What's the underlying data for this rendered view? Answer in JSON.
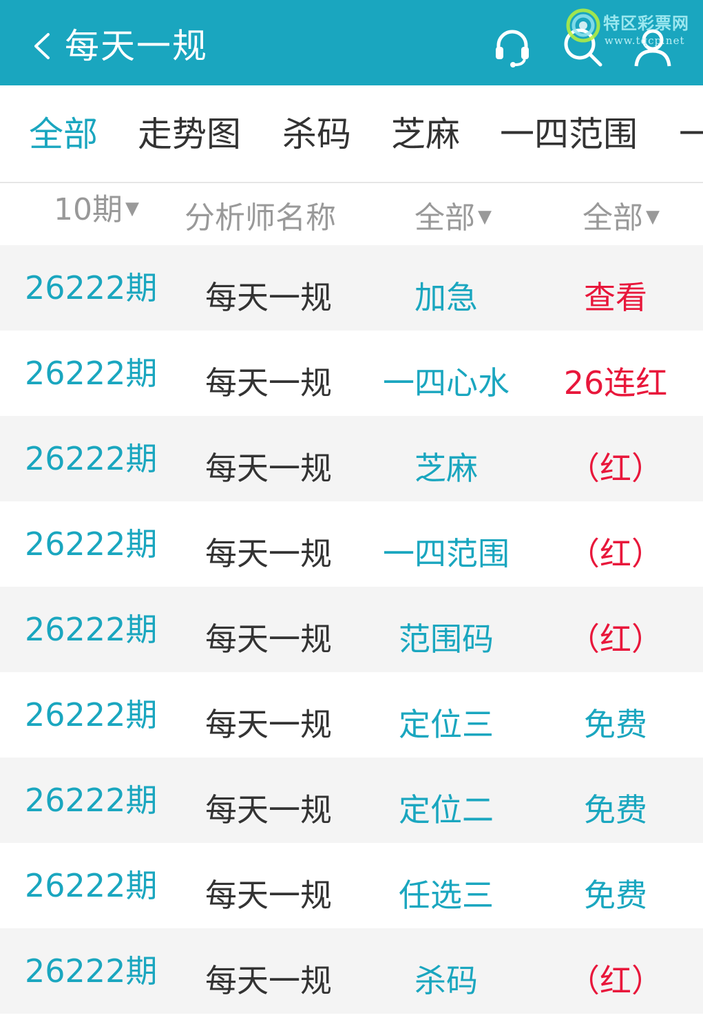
{
  "header": {
    "title": "每天一规",
    "colors": {
      "background": "#1aa6bf",
      "text": "#ffffff"
    },
    "icons": [
      "chevron-left-icon",
      "headset-icon",
      "search-icon",
      "user-icon"
    ]
  },
  "watermark": {
    "brand": "特区彩票网",
    "site": "www.tqcp.net"
  },
  "tabs": [
    {
      "label": "全部",
      "active": true
    },
    {
      "label": "走势图",
      "active": false
    },
    {
      "label": "杀码",
      "active": false
    },
    {
      "label": "芝麻",
      "active": false
    },
    {
      "label": "一四范围",
      "active": false
    },
    {
      "label": "一",
      "active": false
    }
  ],
  "filters": {
    "period": "10期",
    "analyst": "分析师名称",
    "category": "全部",
    "status": "全部",
    "dropdown_glyph": "▼"
  },
  "rows": [
    {
      "period": "26222期",
      "name": "每天一规",
      "category": "加急",
      "status": "查看",
      "status_color": "red"
    },
    {
      "period": "26222期",
      "name": "每天一规",
      "category": "一四心水",
      "status": "26连红",
      "status_color": "red"
    },
    {
      "period": "26222期",
      "name": "每天一规",
      "category": "芝麻",
      "status": "（红）",
      "status_color": "red"
    },
    {
      "period": "26222期",
      "name": "每天一规",
      "category": "一四范围",
      "status": "（红）",
      "status_color": "red"
    },
    {
      "period": "26222期",
      "name": "每天一规",
      "category": "范围码",
      "status": "（红）",
      "status_color": "red"
    },
    {
      "period": "26222期",
      "name": "每天一规",
      "category": "定位三",
      "status": "免费",
      "status_color": "teal"
    },
    {
      "period": "26222期",
      "name": "每天一规",
      "category": "定位二",
      "status": "免费",
      "status_color": "teal"
    },
    {
      "period": "26222期",
      "name": "每天一规",
      "category": "任选三",
      "status": "免费",
      "status_color": "teal"
    },
    {
      "period": "26222期",
      "name": "每天一规",
      "category": "杀码",
      "status": "（红）",
      "status_color": "red"
    }
  ],
  "colors": {
    "accent": "#1aa6bf",
    "red": "#e8173b",
    "text": "#333333",
    "muted": "#999999",
    "row_alt": "#f4f4f4"
  }
}
